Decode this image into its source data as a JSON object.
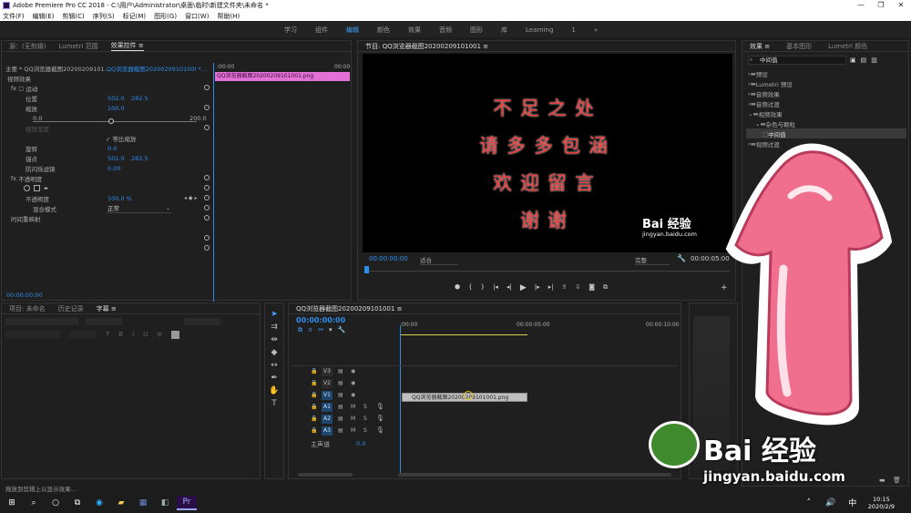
{
  "window": {
    "title": "Adobe Premiere Pro CC 2018 - C:\\用户\\Administrator\\桌面\\临时\\新建文件夹\\未命名 *",
    "controls": [
      "—",
      "❐",
      "✕"
    ]
  },
  "menu": [
    "文件(F)",
    "编辑(E)",
    "剪辑(C)",
    "序列(S)",
    "标记(M)",
    "图形(G)",
    "窗口(W)",
    "帮助(H)"
  ],
  "workspaces": {
    "items": [
      "学习",
      "组件",
      "编辑",
      "颜色",
      "效果",
      "音频",
      "图形",
      "库",
      "Learning"
    ],
    "active_index": 2,
    "extra": "1",
    "more": "»"
  },
  "source_panel": {
    "tabs": [
      "源：(无剪辑)",
      "Lumetri 范围",
      "效果控件 ≡"
    ],
    "active_tab": 2,
    "header_left": "主要 * QQ浏览器截图20200209101...",
    "header_right": "QQ浏览器截图2020020910100I *...",
    "time_start": ":00:00",
    "time_end": "00:00",
    "clip_label": "QQ浏览器截图20200209101001.png",
    "section_video": "视频效果",
    "props": [
      {
        "label": "运动",
        "indent": 1,
        "fx": true
      },
      {
        "label": "位置",
        "indent": 2,
        "v1": "502.0",
        "v2": "282.5"
      },
      {
        "label": "缩放",
        "indent": 2,
        "v1": "100.0",
        "v2": ""
      },
      {
        "label": "0.0",
        "indent": 3,
        "v1": "",
        "v2": "200.0"
      },
      {
        "label": "缩放宽度",
        "indent": 2,
        "v1": "",
        "v2": "",
        "dim": true
      },
      {
        "label": "✓ 等比缩放",
        "indent": 6,
        "v1": "",
        "v2": ""
      },
      {
        "label": "旋转",
        "indent": 2,
        "v1": "0.0",
        "v2": ""
      },
      {
        "label": "锚点",
        "indent": 2,
        "v1": "502.0",
        "v2": "282.5"
      },
      {
        "label": "防闪烁滤镜",
        "indent": 2,
        "v1": "0.00",
        "v2": ""
      },
      {
        "label": "不透明度",
        "indent": 1,
        "fx": true
      },
      {
        "label": "",
        "indent": 2,
        "shapes": true
      },
      {
        "label": "不透明度",
        "indent": 2,
        "v1": "100.0 %",
        "v2": ""
      },
      {
        "label": "混合模式",
        "indent": 3,
        "v1": "正常",
        "v2": ""
      },
      {
        "label": "时间重映射",
        "indent": 1,
        "fx": false
      }
    ],
    "timecode": "00:00:00:00"
  },
  "program_panel": {
    "title": "节目: QQ浏览器截图20200209101001 ≡",
    "lines": [
      "不足之处",
      "请多多包涵",
      "欢迎留言",
      "谢谢"
    ],
    "watermark_brand": "Bai 经验",
    "watermark_url": "jingyan.baidu.com",
    "timecode_left": "00:00:00:00",
    "fit": "适合",
    "quality": "完整",
    "timecode_right": "00:00:05:00"
  },
  "effects_panel": {
    "tabs": [
      "效果 ≡",
      "基本图形",
      "Lumetri 颜色"
    ],
    "search_value": "中间值",
    "tree": [
      {
        "label": "预设",
        "level": 0
      },
      {
        "label": "Lumetri 预设",
        "level": 0
      },
      {
        "label": "音频效果",
        "level": 0
      },
      {
        "label": "音频过渡",
        "level": 0
      },
      {
        "label": "视频效果",
        "level": 0,
        "open": true
      },
      {
        "label": "杂色与颗粒",
        "level": 1,
        "open": true
      },
      {
        "label": "中间值",
        "level": 2,
        "selected": true
      },
      {
        "label": "视频过渡",
        "level": 0
      }
    ]
  },
  "project_panel": {
    "tabs": [
      "项目: 未命名",
      "历史记录",
      "字幕 ≡"
    ],
    "active_tab": 2,
    "status": "拖放到剪辑上以显示效果..."
  },
  "timeline": {
    "title": "QQ浏览器截图20200209101001 ≡",
    "timecode": "00:00:00:00",
    "ruler": [
      ":00:00",
      "00:00:05:00",
      "00:00:10:00"
    ],
    "video_tracks": [
      "V3",
      "V2",
      "V1"
    ],
    "audio_tracks": [
      "A1",
      "A2",
      "A3"
    ],
    "master": "主声道",
    "master_value": "0.0",
    "clip_label": "QQ浏览器截图20200209101001.png"
  },
  "watermark": {
    "brand": "Bai 经验",
    "url": "jingyan.baidu.com"
  },
  "taskbar": {
    "time": "10:15",
    "date": "2020/2/9",
    "lang": "中"
  },
  "colors": {
    "accent": "#2d8ceb",
    "clip": "#e472d6",
    "title_text": "#ef3a3a",
    "arrow": "#f06e8e"
  }
}
